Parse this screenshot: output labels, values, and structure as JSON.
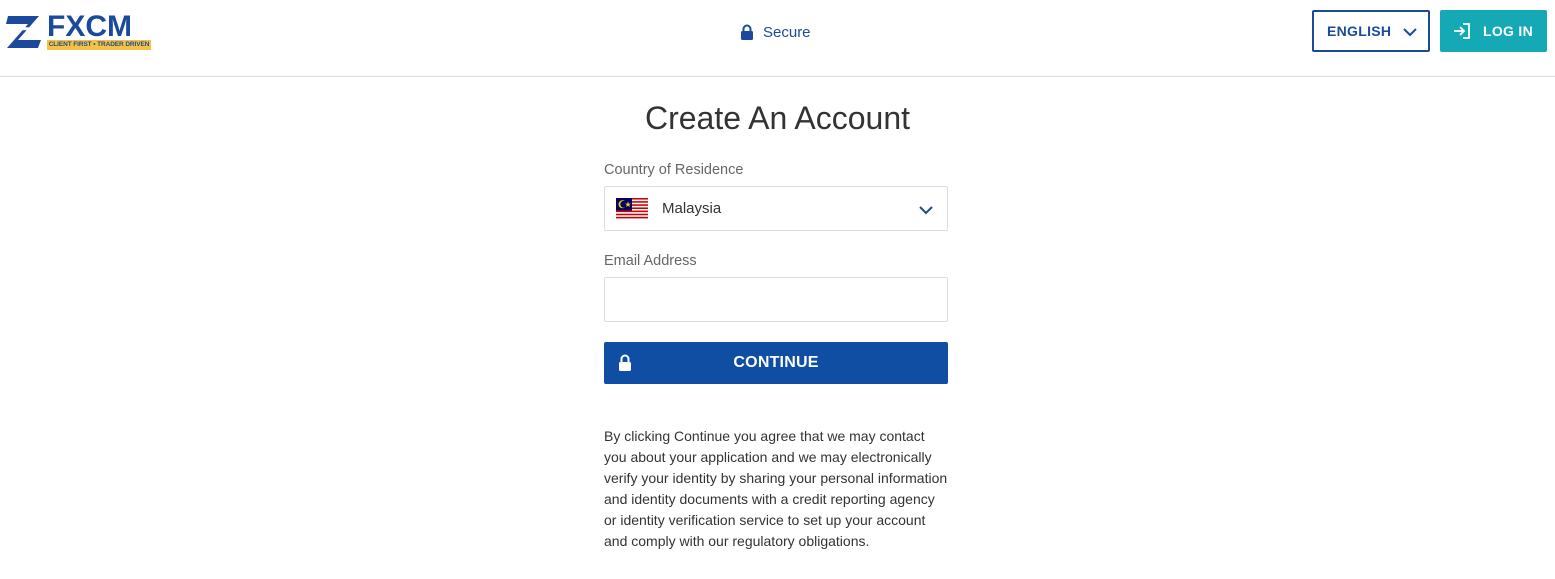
{
  "header": {
    "logo": {
      "brand": "FXCM",
      "tagline": "CLIENT FIRST • TRADER DRIVEN"
    },
    "secure_label": "Secure",
    "language_button": "ENGLISH",
    "login_button": "LOG IN",
    "colors": {
      "brand_blue": "#1b4a9c",
      "login_teal": "#14a9b5",
      "tagline_yellow": "#f5c242"
    }
  },
  "form": {
    "title": "Create An Account",
    "country": {
      "label": "Country of Residence",
      "value": "Malaysia",
      "flag_icon": "malaysia-flag-icon"
    },
    "email": {
      "label": "Email Address",
      "value": "",
      "placeholder": ""
    },
    "continue_button": "CONTINUE",
    "continue_color": "#0f4ea3",
    "disclaimer": "By clicking Continue you agree that we may contact you about your application and we may electronically verify your identity by sharing your personal information and identity documents with a credit reporting agency or identity verification service to set up your account and comply with our regulatory obligations."
  }
}
